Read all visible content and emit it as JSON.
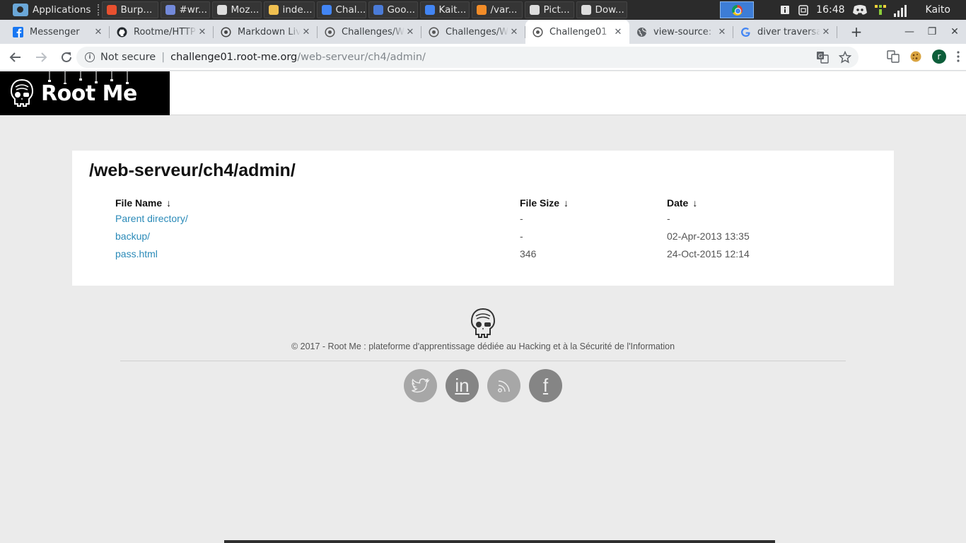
{
  "taskbar": {
    "apps_label": "Applications",
    "tasks": [
      {
        "label": "Burp...",
        "icon": "burp-icon",
        "color": "#e8502f"
      },
      {
        "label": "#wr...",
        "icon": "discord-icon",
        "color": "#7289da"
      },
      {
        "label": "Moz...",
        "icon": "mozilla-icon",
        "color": "#dddddd"
      },
      {
        "label": "inde...",
        "icon": "text-editor-icon",
        "color": "#f0c050"
      },
      {
        "label": "Chal...",
        "icon": "chrome-icon",
        "color": "#4285f4"
      },
      {
        "label": "Goo...",
        "icon": "google-translate-icon",
        "color": "#4a7bd8"
      },
      {
        "label": "Kait...",
        "icon": "chrome-icon",
        "color": "#4285f4"
      },
      {
        "label": "/var...",
        "icon": "sublime-icon",
        "color": "#f28c28"
      },
      {
        "label": "Pict...",
        "icon": "camera-icon",
        "color": "#dddddd"
      },
      {
        "label": "Dow...",
        "icon": "download-icon",
        "color": "#dddddd"
      }
    ],
    "clock": "16:48",
    "user": "Kaito"
  },
  "browser": {
    "tabs": [
      {
        "title": "Messenger",
        "icon": "facebook-icon"
      },
      {
        "title": "Rootme/HTTP",
        "icon": "github-icon"
      },
      {
        "title": "Markdown Live",
        "icon": "markdown-icon"
      },
      {
        "title": "Challenges/Web",
        "icon": "rootme-icon"
      },
      {
        "title": "Challenges/Web",
        "icon": "rootme-icon"
      },
      {
        "title": "Challenge01",
        "icon": "rootme-icon",
        "active": true
      },
      {
        "title": "view-source:",
        "icon": "globe-icon"
      },
      {
        "title": "diver traversal",
        "icon": "google-icon"
      }
    ],
    "address": {
      "security": "Not secure",
      "host": "challenge01.root-me.org",
      "path": "/web-serveur/ch4/admin/"
    },
    "profile_initial": "r"
  },
  "site": {
    "brand": "Root Me"
  },
  "listing": {
    "title": "/web-serveur/ch4/admin/",
    "headers": {
      "name": "File Name",
      "size": "File Size",
      "date": "Date",
      "sort_glyph": "↓"
    },
    "rows": [
      {
        "name": "Parent directory/",
        "size": "-",
        "date": "-"
      },
      {
        "name": "backup/",
        "size": "-",
        "date": "02-Apr-2013 13:35"
      },
      {
        "name": "pass.html",
        "size": "346",
        "date": "24-Oct-2015 12:14"
      }
    ]
  },
  "footer": {
    "copyright": "© 2017 - Root Me : plateforme d'apprentissage dédiée au Hacking et à la Sécurité de l'Information",
    "socials": [
      {
        "name": "twitter",
        "glyph": "",
        "icon": "twitter-icon"
      },
      {
        "name": "linkedin",
        "glyph": "in",
        "icon": "linkedin-icon"
      },
      {
        "name": "rss",
        "glyph": "",
        "icon": "rss-icon"
      },
      {
        "name": "facebook",
        "glyph": "f",
        "icon": "facebook-icon"
      }
    ]
  },
  "colors": {
    "link": "#2a8ab8",
    "page_bg": "#ebebeb",
    "brand_bg": "#000000"
  }
}
